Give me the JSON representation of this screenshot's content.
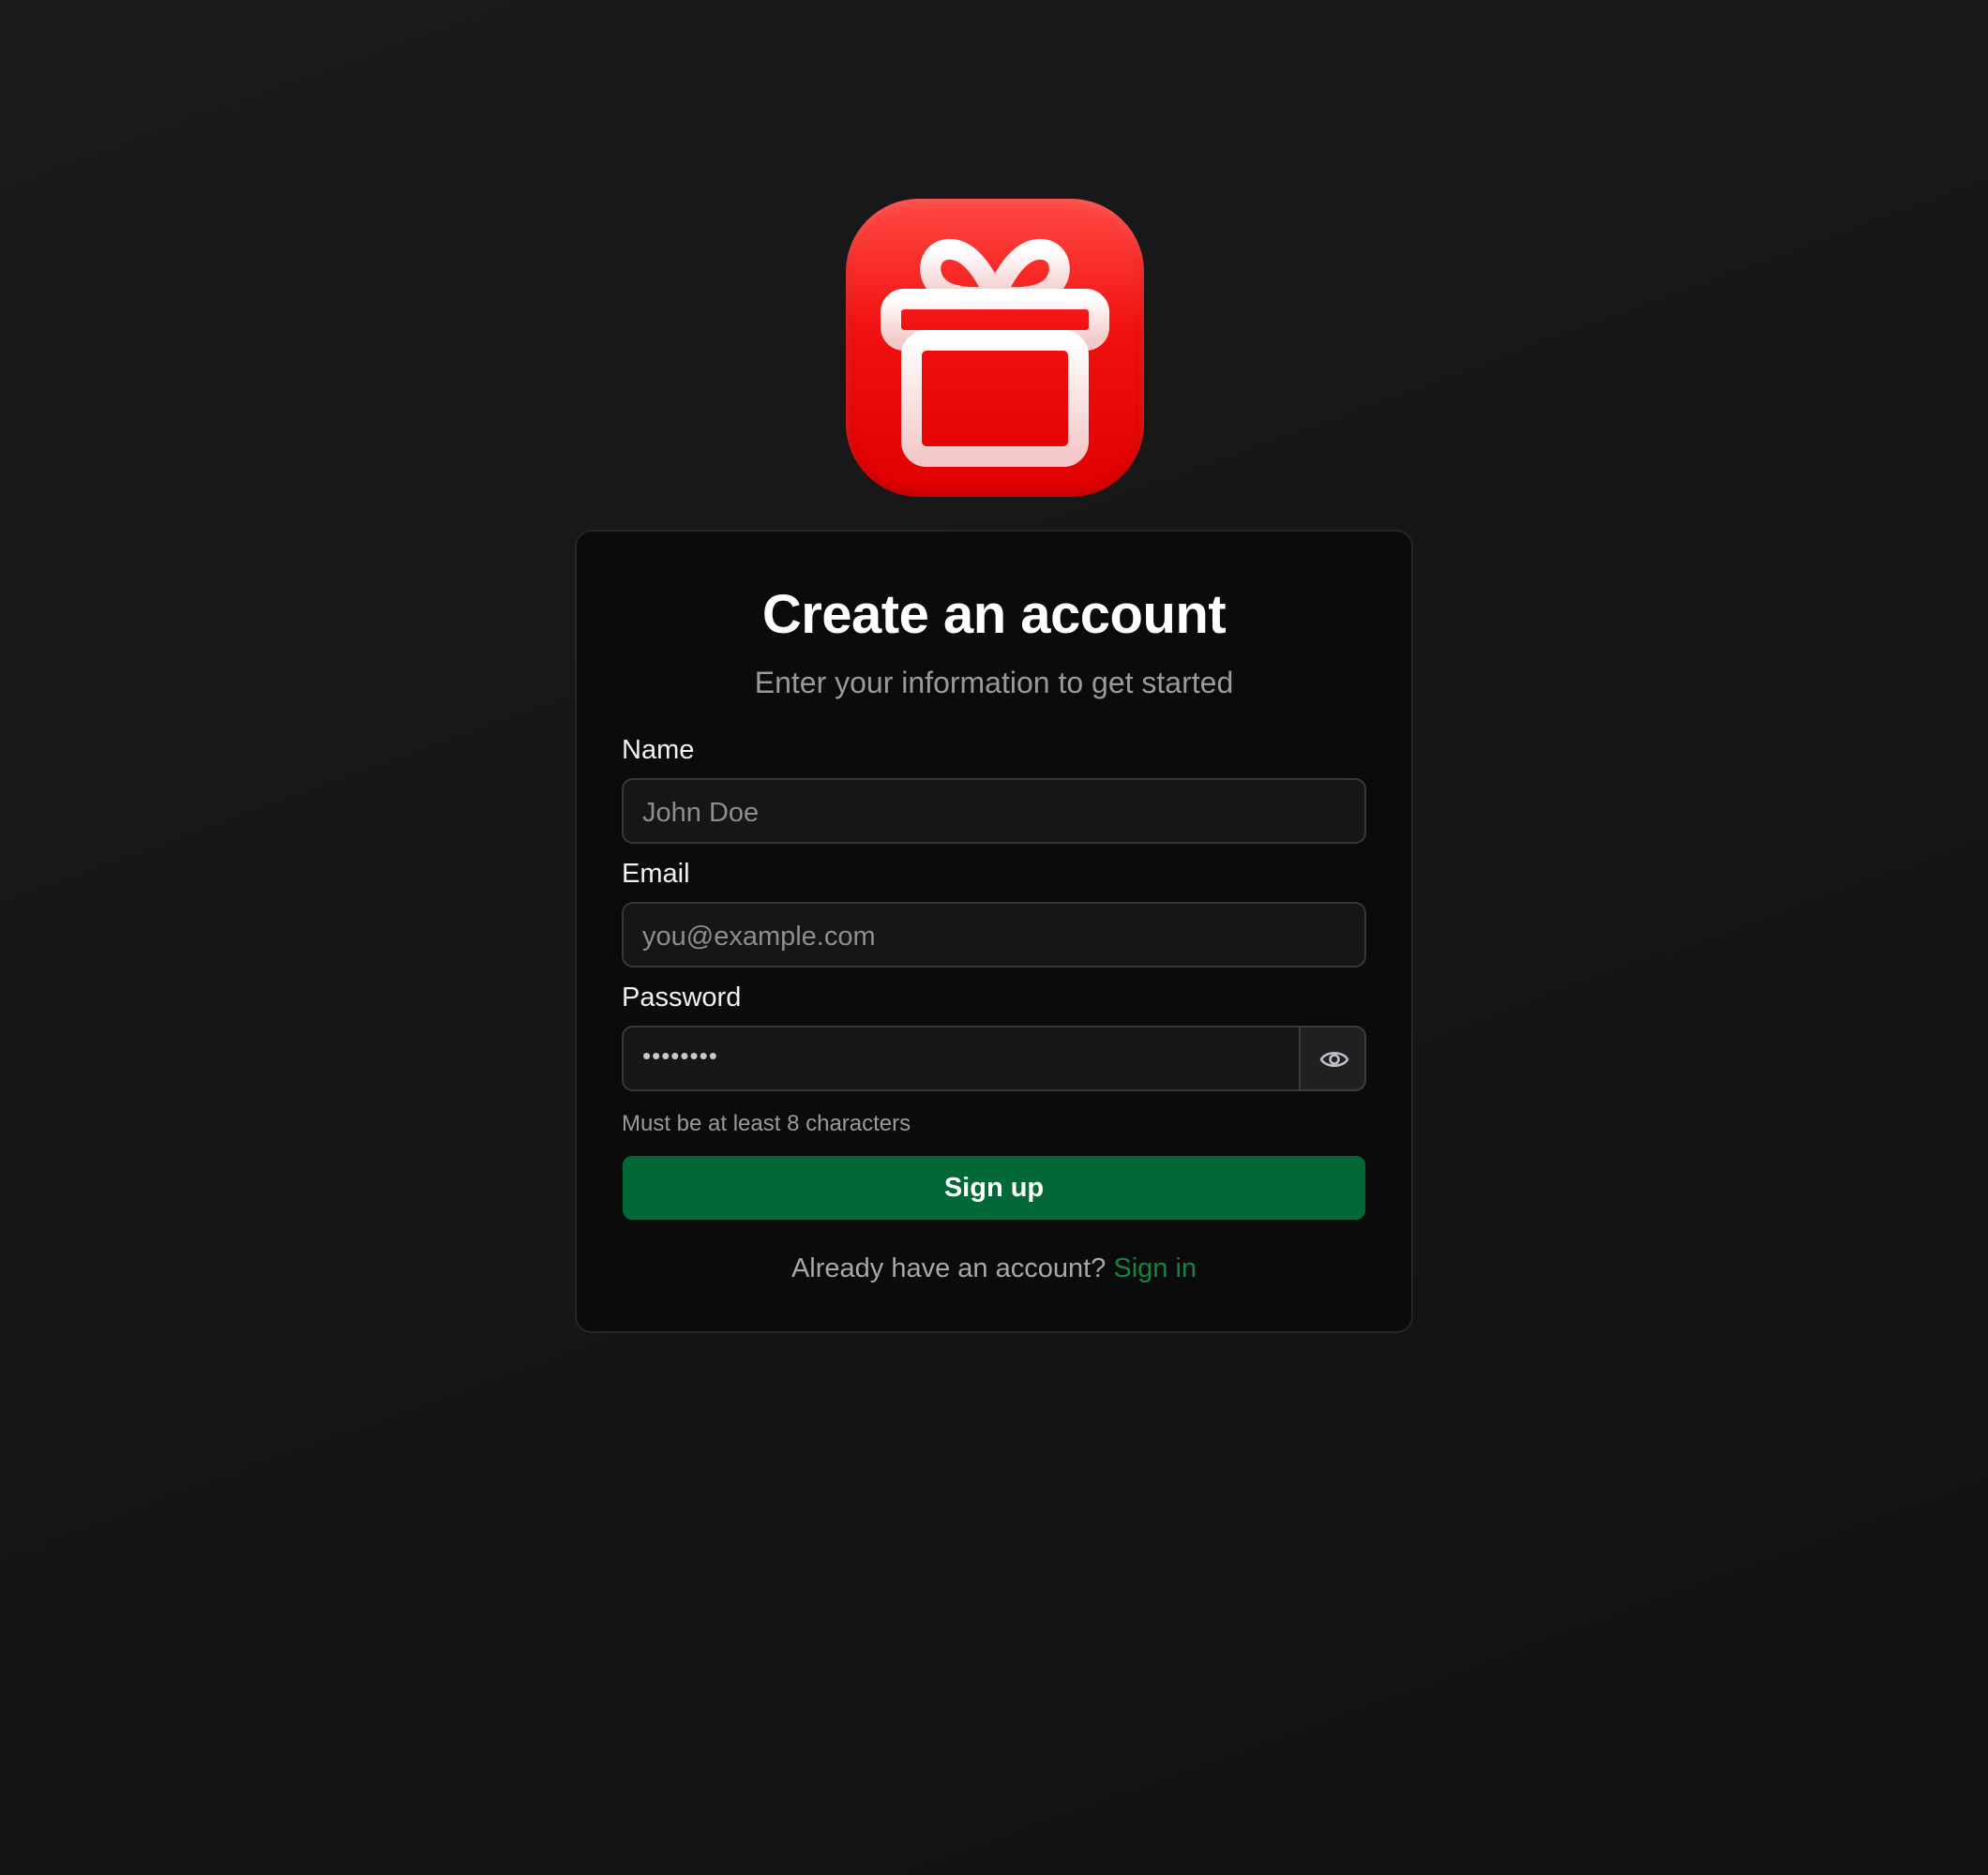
{
  "app": {
    "logo_icon": "gift-icon",
    "logo_color": "#ee0a0a"
  },
  "card": {
    "title": "Create an account",
    "subtitle": "Enter your information to get started"
  },
  "form": {
    "name": {
      "label": "Name",
      "placeholder": "John Doe"
    },
    "email": {
      "label": "Email",
      "placeholder": "you@example.com"
    },
    "password": {
      "label": "Password",
      "value_masked": "••••••••",
      "toggle_icon": "eye-icon",
      "hint": "Must be at least 8 characters"
    },
    "submit_label": "Sign up"
  },
  "footer": {
    "prompt": "Already have an account?",
    "link_label": "Sign in"
  },
  "colors": {
    "accent": "#026836",
    "link": "#12843f"
  }
}
